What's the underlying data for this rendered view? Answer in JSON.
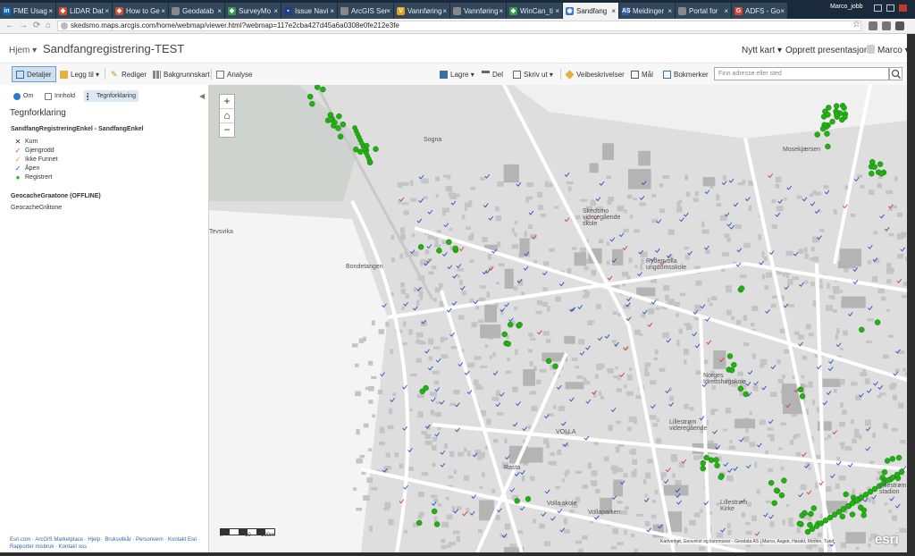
{
  "browser": {
    "tabs": [
      {
        "label": "FME Usag",
        "icon": "in",
        "color": "#0a66c2"
      },
      {
        "label": "LiDAR Dat",
        "icon": "◆",
        "color": "#d84a2b"
      },
      {
        "label": "How to Ge",
        "icon": "◆",
        "color": "#d84a2b"
      },
      {
        "label": "Geodatab",
        "icon": "",
        "color": "#888888"
      },
      {
        "label": "SurveyMo",
        "icon": "◆",
        "color": "#2ea043"
      },
      {
        "label": "Issue Navi",
        "icon": "▪",
        "color": "#1d3f8a"
      },
      {
        "label": "ArcGIS Ser",
        "icon": "",
        "color": "#888888"
      },
      {
        "label": "Vannføring",
        "icon": "V",
        "color": "#e3a21a"
      },
      {
        "label": "Vannføring",
        "icon": "",
        "color": "#888888"
      },
      {
        "label": "WinCan_ti",
        "icon": "◆",
        "color": "#2ea043"
      },
      {
        "label": "Sandfang",
        "icon": "◉",
        "color": "#2f7ad0"
      },
      {
        "label": "Meldinger",
        "icon": "AS",
        "color": "#2d5fa8"
      },
      {
        "label": "Portal for",
        "icon": "",
        "color": "#888888"
      },
      {
        "label": "ADFS - Go",
        "icon": "G",
        "color": "#e34133"
      }
    ],
    "active_tab": 10,
    "user": "Marco_jobb",
    "url": "skedsmo.maps.arcgis.com/home/webmap/viewer.html?webmap=117e2cba427d45a6a0308e0fe212e3fe"
  },
  "header": {
    "home": "Hjem",
    "title": "Sandfangregistrering-TEST",
    "new_map": "Nytt kart",
    "create_presentation": "Opprett presentasjon",
    "user": "Marco"
  },
  "toolbar": {
    "details": "Detaljer",
    "add": "Legg til",
    "edit": "Rediger",
    "basemap": "Bakgrunnskart",
    "analysis": "Analyse",
    "save": "Lagre",
    "share": "Del",
    "print": "Skriv ut",
    "directions": "Veibeskrivelser",
    "measure": "Mål",
    "bookmarks": "Bokmerker",
    "search_placeholder": "Finn adresse eller sted"
  },
  "panel": {
    "tab_about": "Om",
    "tab_content": "Innhold",
    "tab_legend": "Tegnforklaring",
    "title": "Tegnforklaring",
    "layer1_title": "SandfangRegistreringEnkel - SandfangEnkel",
    "legend": [
      {
        "label": "Kum",
        "symbol": "✕",
        "color": "#333333"
      },
      {
        "label": "Gjengrodd",
        "symbol": "✓",
        "color": "#d23a3a"
      },
      {
        "label": "Ikke Funnet",
        "symbol": "✓",
        "color": "#e0a020"
      },
      {
        "label": "Åpen",
        "symbol": "✓",
        "color": "#2a4fc2"
      },
      {
        "label": "Registrert",
        "symbol": "●",
        "color": "#22b014"
      }
    ],
    "layer2_title": "GeocacheGraatone (OFFLINE)",
    "layer2_sub": "GeocacheGråtone",
    "footer": "Esri.com · ArcGIS Marketplace · Hjelp · Bruksvilkår · Personvern · Kontakt Esri · Rapporter misbruk · Kontakt oss"
  },
  "map": {
    "labels": [
      "Sogna",
      "Bondetangen",
      "Skedsmo videregående skole",
      "Rydenvolla ungdomsskole",
      "Lillestrøm videregående",
      "Volla skole",
      "Vollaparken",
      "Norges Idrettshøgskole",
      "Mosekjærsen",
      "Lillestrøm Kirke",
      "Lillestrøm stadion",
      "Tevsvika",
      "VOLLA",
      "Rasta"
    ],
    "scale_labels": [
      "0",
      "50",
      "100m"
    ],
    "attribution": "Kartverket, Geovekst og kommuner - Geodata AS | Marco, Asgeir, Harald, Morten, Tund",
    "logo": "esri",
    "registered_color": "#22b014",
    "open_color": "#2a4fc2",
    "overgrown_color": "#d23a3a"
  }
}
